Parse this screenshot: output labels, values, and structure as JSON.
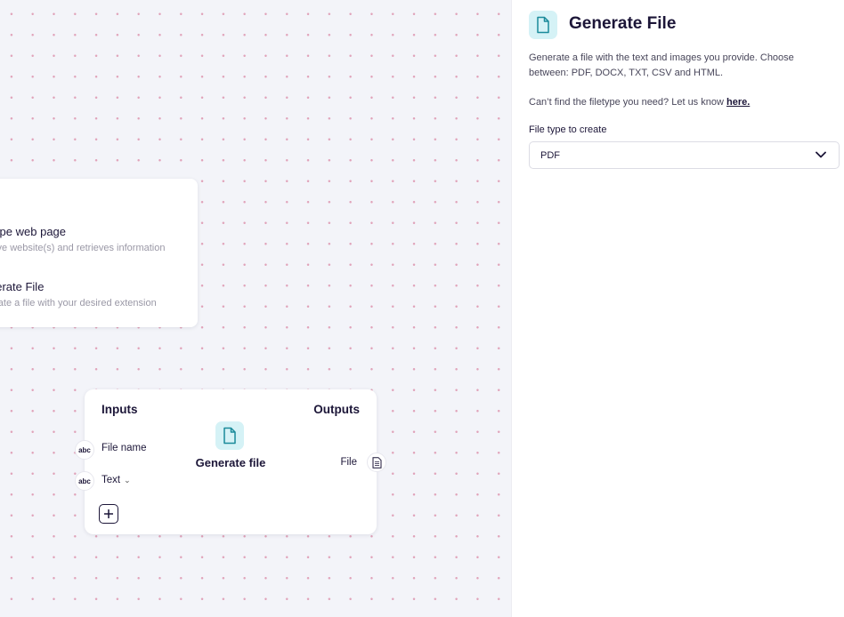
{
  "canvas": {
    "menu": {
      "items": [
        {
          "title": "rape web page",
          "description": "eive website(s) and retrieves information"
        },
        {
          "title": "nerate File",
          "description": "erate a file with your desired extension"
        }
      ]
    },
    "node": {
      "inputs_header": "Inputs",
      "outputs_header": "Outputs",
      "center_label": "Generate file",
      "center_icon": "file-icon",
      "inputs": [
        {
          "port_label": "abc",
          "label": "File name"
        },
        {
          "port_label": "abc",
          "label": "Text",
          "dropdown_icon": "chevron-down-icon"
        }
      ],
      "output": {
        "label": "File",
        "icon": "document-icon"
      },
      "add_input_icon": "plus-square-icon"
    }
  },
  "panel": {
    "icon": "file-icon",
    "title": "Generate File",
    "description": "Generate a file with the text and images you provide. Choose between: PDF, DOCX, TXT, CSV and HTML.",
    "help_text": "Can’t find the filetype you need? Let us know ",
    "help_link": "here.",
    "field_label": "File type to create",
    "field_value": "PDF"
  },
  "colors": {
    "canvas_bg": "#f3f4f9",
    "dot": "#e0a2b9",
    "icon_bg": "#d5f2f6",
    "icon_stroke": "#1a8a9a",
    "text_dark": "#1c1638"
  }
}
